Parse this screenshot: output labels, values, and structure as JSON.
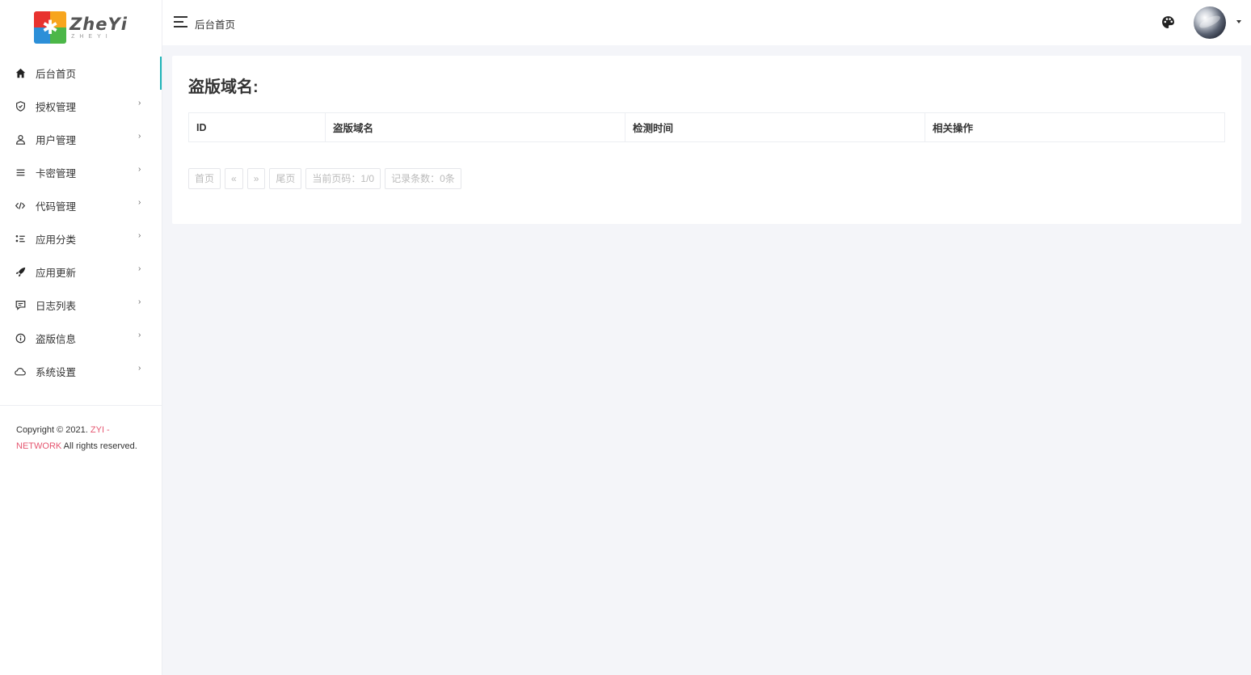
{
  "brand": {
    "name": "ZheYi",
    "sub": "ZHEYI"
  },
  "sidebar": {
    "items": [
      {
        "label": "后台首页",
        "icon": "home-icon"
      },
      {
        "label": "授权管理",
        "icon": "shield-icon"
      },
      {
        "label": "用户管理",
        "icon": "user-icon"
      },
      {
        "label": "卡密管理",
        "icon": "list-icon"
      },
      {
        "label": "代码管理",
        "icon": "code-icon"
      },
      {
        "label": "应用分类",
        "icon": "category-icon"
      },
      {
        "label": "应用更新",
        "icon": "rocket-icon"
      },
      {
        "label": "日志列表",
        "icon": "message-icon"
      },
      {
        "label": "盗版信息",
        "icon": "info-icon"
      },
      {
        "label": "系统设置",
        "icon": "cloud-icon"
      }
    ],
    "caret": "›"
  },
  "footer": {
    "prefix": "Copyright © 2021. ",
    "brand": "ZYI - NETWORK",
    "suffix": " All rights reserved."
  },
  "header": {
    "breadcrumb": "后台首页"
  },
  "main": {
    "title": "盗版域名:",
    "columns": [
      "ID",
      "盗版域名",
      "检测时间",
      "相关操作"
    ],
    "rows": [],
    "pager": {
      "first": "首页",
      "prev": "«",
      "next": "»",
      "last": "尾页",
      "page_info": "当前页码：1/0",
      "count_info": "记录条数：0条"
    }
  },
  "colors": {
    "accent": "#20b4b8",
    "brand_link": "#e5556f",
    "background": "#f4f5f9"
  }
}
